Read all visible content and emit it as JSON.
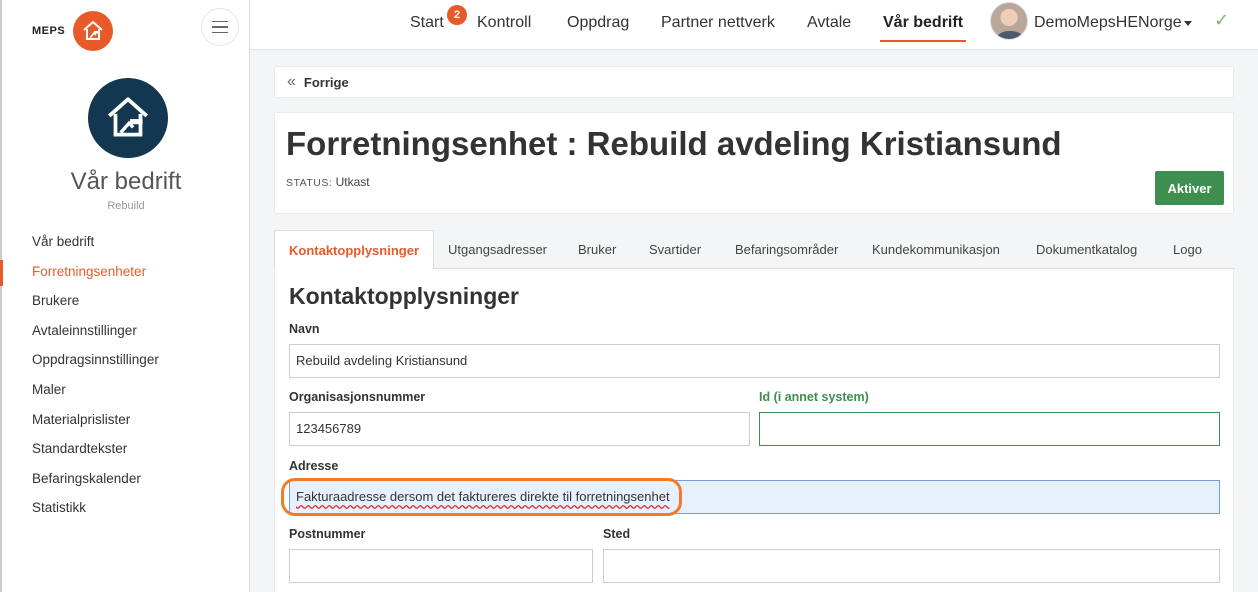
{
  "brand": {
    "text": "MEPS"
  },
  "sidebar": {
    "company_name": "Vår bedrift",
    "company_sub": "Rebuild",
    "items": [
      {
        "label": "Vår bedrift"
      },
      {
        "label": "Forretningsenheter"
      },
      {
        "label": "Brukere"
      },
      {
        "label": "Avtaleinnstillinger"
      },
      {
        "label": "Oppdragsinnstillinger"
      },
      {
        "label": "Maler"
      },
      {
        "label": "Materialprislister"
      },
      {
        "label": "Standardtekster"
      },
      {
        "label": "Befaringskalender"
      },
      {
        "label": "Statistikk"
      }
    ],
    "active_index": 1
  },
  "topnav": {
    "items": [
      {
        "label": "Start"
      },
      {
        "label": "Kontroll"
      },
      {
        "label": "Oppdrag"
      },
      {
        "label": "Partner nettverk"
      },
      {
        "label": "Avtale"
      },
      {
        "label": "Vår bedrift"
      }
    ],
    "badge": "2",
    "username": "DemoMepsHENorge",
    "active": "Vår bedrift"
  },
  "breadcrumb": {
    "back_label": "Forrige"
  },
  "header": {
    "title": "Forretningsenhet : Rebuild avdeling Kristiansund",
    "status_label": "STATUS:",
    "status_value": "Utkast",
    "activate_button": "Aktiver"
  },
  "tabs": [
    {
      "label": "Kontaktopplysninger"
    },
    {
      "label": "Utgangsadresser"
    },
    {
      "label": "Bruker"
    },
    {
      "label": "Svartider"
    },
    {
      "label": "Befaringsområder"
    },
    {
      "label": "Kundekommunikasjon"
    },
    {
      "label": "Dokumentkatalog"
    },
    {
      "label": "Logo"
    }
  ],
  "form": {
    "section_title": "Kontaktopplysninger",
    "name_label": "Navn",
    "name_value": "Rebuild avdeling Kristiansund",
    "org_label": "Organisasjonsnummer",
    "org_value": "123456789",
    "extid_label": "Id (i annet system)",
    "extid_value": "",
    "address_label": "Adresse",
    "address_value": "Fakturaadresse dersom det faktureres direkte til forretningsenhet",
    "postnr_label": "Postnummer",
    "postnr_value": "",
    "place_label": "Sted",
    "place_value": ""
  },
  "colors": {
    "accent": "#e85a2a",
    "primary_dark": "#133750",
    "success": "#3e8e4f",
    "highlight_ring": "#f07b2b"
  }
}
